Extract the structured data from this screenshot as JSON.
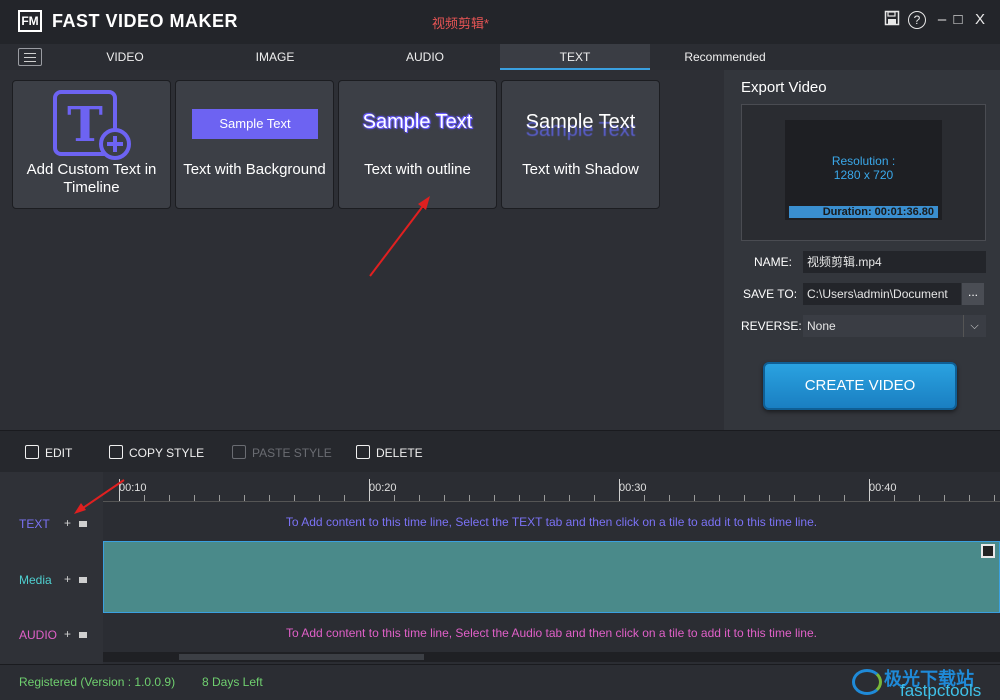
{
  "app": {
    "title": "FAST VIDEO MAKER",
    "logo_text": "FM",
    "project_name": "视频剪辑*"
  },
  "window_controls": {
    "save_icon": "save-icon",
    "help": "?",
    "minimize": "–",
    "maximize": "□",
    "close": "X"
  },
  "nav": {
    "tabs": [
      {
        "label": "VIDEO"
      },
      {
        "label": "IMAGE"
      },
      {
        "label": "AUDIO"
      },
      {
        "label": "TEXT"
      },
      {
        "label": "Recommended"
      }
    ],
    "active_tab": "TEXT"
  },
  "tiles": [
    {
      "label": "Add Custom Text in Timeline"
    },
    {
      "label": "Text with Background",
      "sample": "Sample Text"
    },
    {
      "label": "Text with outline",
      "sample": "Sample Text"
    },
    {
      "label": "Text with Shadow",
      "sample": "Sample Text"
    }
  ],
  "export": {
    "title": "Export Video",
    "resolution_label": "Resolution :",
    "resolution_value": "1280 x 720",
    "duration": "Duration: 00:01:36.80",
    "name_label": "NAME:",
    "name_value": "视频剪辑.mp4",
    "save_label": "SAVE TO:",
    "save_value": "C:\\Users\\admin\\Document",
    "browse": "...",
    "reverse_label": "REVERSE:",
    "reverse_value": "None",
    "create_button": "CREATE VIDEO"
  },
  "toolbar": {
    "edit": "EDIT",
    "copy_style": "COPY STYLE",
    "paste_style": "PASTE STYLE",
    "delete": "DELETE"
  },
  "timeline": {
    "ruler_labels": [
      "00:10",
      "00:20",
      "00:30",
      "00:40"
    ],
    "tracks": [
      {
        "name": "TEXT",
        "message": "To Add content to this time line, Select the TEXT tab and then click on a tile to add it to this time line."
      },
      {
        "name": "Media",
        "message": ""
      },
      {
        "name": "AUDIO",
        "message": "To Add content to this time line, Select the Audio tab and then click on a tile to add it to this time line."
      }
    ]
  },
  "status": {
    "registered": "Registered (Version : 1.0.0.9)",
    "days_left": "8 Days Left"
  },
  "watermark": {
    "cn": "极光下载站",
    "en": "fastpctools"
  },
  "colors": {
    "accent": "#3aa0e0",
    "text_track": "#7b72f5",
    "media_track": "#4fd0d0",
    "audio_track": "#e060c8",
    "status_green": "#6fcf6f",
    "create_button": "#1f8fd2"
  }
}
